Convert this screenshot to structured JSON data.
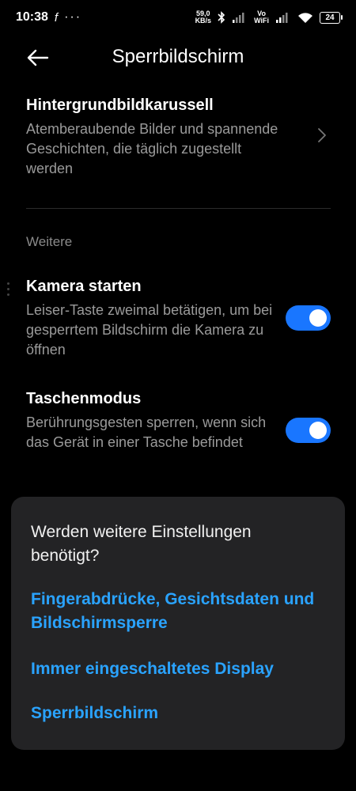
{
  "status_bar": {
    "time": "10:38",
    "carrier_glyph": "f",
    "more": "···",
    "speed_value": "59,0",
    "speed_unit": "KB/s",
    "vowifi_top": "Vo",
    "vowifi_bottom": "WiFi",
    "battery": "24"
  },
  "header": {
    "title": "Sperrbildschirm"
  },
  "settings": {
    "carousel": {
      "title": "Hintergrundbildkarussell",
      "description": "Atemberaubende Bilder und spannende Geschichten, die täglich zugestellt werden"
    },
    "section_label": "Weitere",
    "camera": {
      "title": "Kamera starten",
      "description": "Leiser-Taste zweimal betätigen, um bei gesperrtem Bildschirm die Kamera zu öffnen",
      "enabled": true
    },
    "pocket": {
      "title": "Taschenmodus",
      "description": "Berührungsgesten sperren, wenn sich das Gerät in einer Tasche befindet",
      "enabled": true
    }
  },
  "more_settings": {
    "heading": "Werden weitere Einstellungen benötigt?",
    "links": [
      "Fingerabdrücke, Gesichtsdaten und Bildschirmsperre",
      "Immer eingeschaltetes Display",
      "Sperrbildschirm"
    ]
  },
  "colors": {
    "accent": "#1976ff",
    "link": "#2aa3ff",
    "background": "#000000",
    "card": "#232325"
  }
}
